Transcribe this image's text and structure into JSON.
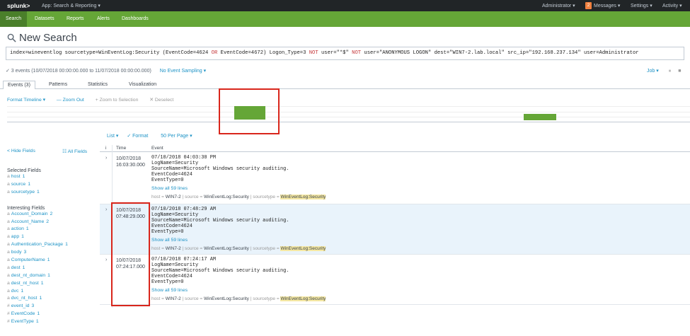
{
  "topbar": {
    "logo": "splunk>",
    "app": "App: Search & Reporting ▾",
    "administrator": "Administrator ▾",
    "messages_count": "2",
    "messages": "Messages ▾",
    "settings": "Settings ▾",
    "activity": "Activity ▾"
  },
  "nav": [
    "Search",
    "Datasets",
    "Reports",
    "Alerts",
    "Dashboards"
  ],
  "page": {
    "title": "New Search",
    "query_prefix": "index=wineventlog sourcetype=WinEventLog:Security (EventCode=4624 ",
    "query_or": "OR",
    "query_mid1": " EventCode=4672) Logon_Type=3 ",
    "query_not1": "NOT",
    "query_mid2": " user=\"*$\" ",
    "query_not2": "NOT",
    "query_suffix": " user=\"ANONYMOUS LOGON\"  dest=\"WIN7-2.lab.local\" src_ip=\"192.168.237.134\" user=Administrator"
  },
  "status": {
    "events": "✓ 3 events (10/07/2018 00:00:00.000 to 11/07/2018 00:00:00.000)",
    "sampling": "No Event Sampling ▾",
    "job": "Job ▾"
  },
  "tabs": [
    "Events (3)",
    "Patterns",
    "Statistics",
    "Visualization"
  ],
  "timeline": {
    "format": "Format Timeline ▾",
    "zoom_out": "— Zoom Out",
    "zoom_sel": "+ Zoom to Selection",
    "deselect": "✕ Deselect"
  },
  "list_controls": {
    "list": "List ▾",
    "format": "✓ Format",
    "per_page": "50 Per Page ▾"
  },
  "fields": {
    "hide": "< Hide Fields",
    "all": "☷ All Fields",
    "selected_title": "Selected Fields",
    "selected": [
      {
        "t": "a",
        "name": "host",
        "count": "1"
      },
      {
        "t": "a",
        "name": "source",
        "count": "1"
      },
      {
        "t": "a",
        "name": "sourcetype",
        "count": "1"
      }
    ],
    "interesting_title": "Interesting Fields",
    "interesting": [
      {
        "t": "a",
        "name": "Account_Domain",
        "count": "2"
      },
      {
        "t": "a",
        "name": "Account_Name",
        "count": "2"
      },
      {
        "t": "a",
        "name": "action",
        "count": "1"
      },
      {
        "t": "a",
        "name": "app",
        "count": "1"
      },
      {
        "t": "a",
        "name": "Authentication_Package",
        "count": "1"
      },
      {
        "t": "a",
        "name": "body",
        "count": "3"
      },
      {
        "t": "a",
        "name": "ComputerName",
        "count": "1"
      },
      {
        "t": "a",
        "name": "dest",
        "count": "1"
      },
      {
        "t": "a",
        "name": "dest_nt_domain",
        "count": "1"
      },
      {
        "t": "a",
        "name": "dest_nt_host",
        "count": "1"
      },
      {
        "t": "a",
        "name": "dvc",
        "count": "1"
      },
      {
        "t": "a",
        "name": "dvc_nt_host",
        "count": "1"
      },
      {
        "t": "#",
        "name": "event_id",
        "count": "3"
      },
      {
        "t": "#",
        "name": "EventCode",
        "count": "1"
      },
      {
        "t": "#",
        "name": "EventType",
        "count": "1"
      }
    ]
  },
  "grid": {
    "col_i": "i",
    "col_time": "Time",
    "col_event": "Event"
  },
  "events": [
    {
      "date": "10/07/2018",
      "time": "16:03:30.000",
      "text": "07/10/2018 04:03:30 PM\nLogName=Security\nSourceName=Microsoft Windows security auditing.\nEventCode=4624\nEventType=0",
      "show": "Show all 59 lines",
      "host": "WIN7-2",
      "source": "WinEventLog:Security",
      "sourcetype": "WinEventLog:Security"
    },
    {
      "date": "10/07/2018",
      "time": "07:48:29.000",
      "text": "07/10/2018 07:48:29 AM\nLogName=Security\nSourceName=Microsoft Windows security auditing.\nEventCode=4624\nEventType=0",
      "show": "Show all 59 lines",
      "host": "WIN7-2",
      "source": "WinEventLog:Security",
      "sourcetype": "WinEventLog:Security"
    },
    {
      "date": "10/07/2018",
      "time": "07:24:17.000",
      "text": "07/10/2018 07:24:17 AM\nLogName=Security\nSourceName=Microsoft Windows security auditing.\nEventCode=4624\nEventType=0",
      "show": "Show all 59 lines",
      "host": "WIN7-2",
      "source": "WinEventLog:Security",
      "sourcetype": "WinEventLog:Security"
    }
  ],
  "meta_labels": {
    "host": "host = ",
    "source": "source = ",
    "sourcetype": "sourcetype = "
  }
}
